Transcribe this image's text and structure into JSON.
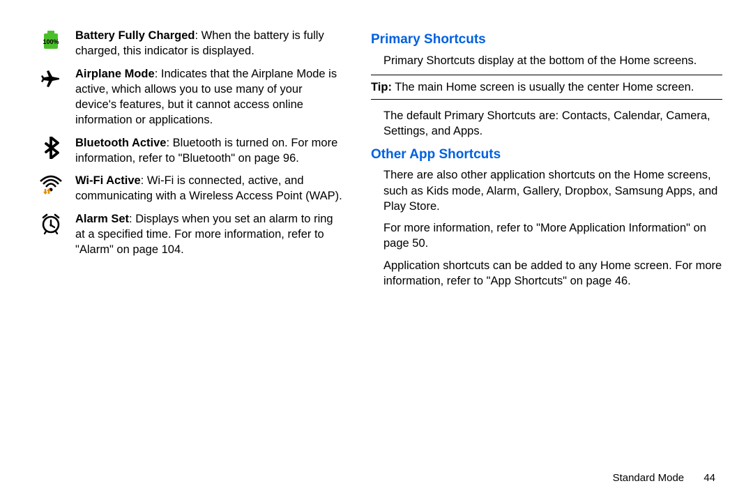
{
  "left": {
    "items": [
      {
        "title": "Battery Fully Charged",
        "rest": ": When the battery is fully charged, this indicator is displayed."
      },
      {
        "title": "Airplane Mode",
        "rest": ": Indicates that the Airplane Mode is active, which allows you to use many of your device's features, but it cannot access online information or applications."
      },
      {
        "title": "Bluetooth Active",
        "rest": ": Bluetooth is turned on. For more information, refer to ",
        "link": "\"Bluetooth\"",
        "tail": " on page 96."
      },
      {
        "title": "Wi-Fi Active",
        "rest": ": Wi-Fi is connected, active, and communicating with a Wireless Access Point (WAP)."
      },
      {
        "title": "Alarm Set",
        "rest": ": Displays when you set an alarm to ring at a specified time. For more information, refer to ",
        "link": "\"Alarm\"",
        "tail": " on page 104."
      }
    ]
  },
  "right": {
    "h1": "Primary Shortcuts",
    "p1": "Primary Shortcuts display at the bottom of the Home screens.",
    "tip_label": "Tip:",
    "tip_text": " The main Home screen is usually the center Home screen.",
    "p2": "The default Primary Shortcuts are: Contacts, Calendar, Camera, Settings, and Apps.",
    "h2": "Other App Shortcuts",
    "p3": "There are also other application shortcuts on the Home screens, such as Kids mode, Alarm, Gallery, Dropbox, Samsung Apps, and Play Store.",
    "p4a": "For more information, refer to ",
    "p4link": "\"More Application Information\"",
    "p4b": " on page 50.",
    "p5a": "Application shortcuts can be added to any Home screen. For more information, refer to ",
    "p5link": "\"App Shortcuts\"",
    "p5b": " on page 46."
  },
  "footer": {
    "section": "Standard Mode",
    "page": "44"
  },
  "battery_label": "100%"
}
